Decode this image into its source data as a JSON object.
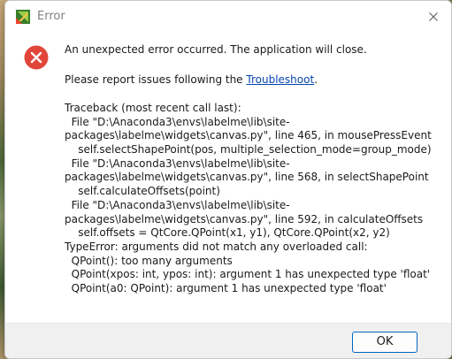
{
  "window": {
    "title": "Error",
    "app_icon": "labelme-icon",
    "close_icon": "close-icon"
  },
  "message": {
    "main": "An unexpected error occurred. The application will close.",
    "report_prefix": "Please report issues following the ",
    "report_link": "Troubleshoot",
    "report_suffix": "."
  },
  "traceback": {
    "lines": [
      "Traceback (most recent call last):",
      "  File \"D:\\Anaconda3\\envs\\labelme\\lib\\site-",
      "packages\\labelme\\widgets\\canvas.py\", line 465, in mousePressEvent",
      "    self.selectShapePoint(pos, multiple_selection_mode=group_mode)",
      "  File \"D:\\Anaconda3\\envs\\labelme\\lib\\site-",
      "packages\\labelme\\widgets\\canvas.py\", line 568, in selectShapePoint",
      "    self.calculateOffsets(point)",
      "  File \"D:\\Anaconda3\\envs\\labelme\\lib\\site-",
      "packages\\labelme\\widgets\\canvas.py\", line 592, in calculateOffsets",
      "    self.offsets = QtCore.QPoint(x1, y1), QtCore.QPoint(x2, y2)",
      "TypeError: arguments did not match any overloaded call:",
      "  QPoint(): too many arguments",
      "  QPoint(xpos: int, ypos: int): argument 1 has unexpected type 'float'",
      "  QPoint(a0: QPoint): argument 1 has unexpected type 'float'"
    ]
  },
  "footer": {
    "ok_label": "OK"
  },
  "colors": {
    "error_red": "#e2463a",
    "link_blue": "#0645ad",
    "button_border": "#0067c0"
  }
}
